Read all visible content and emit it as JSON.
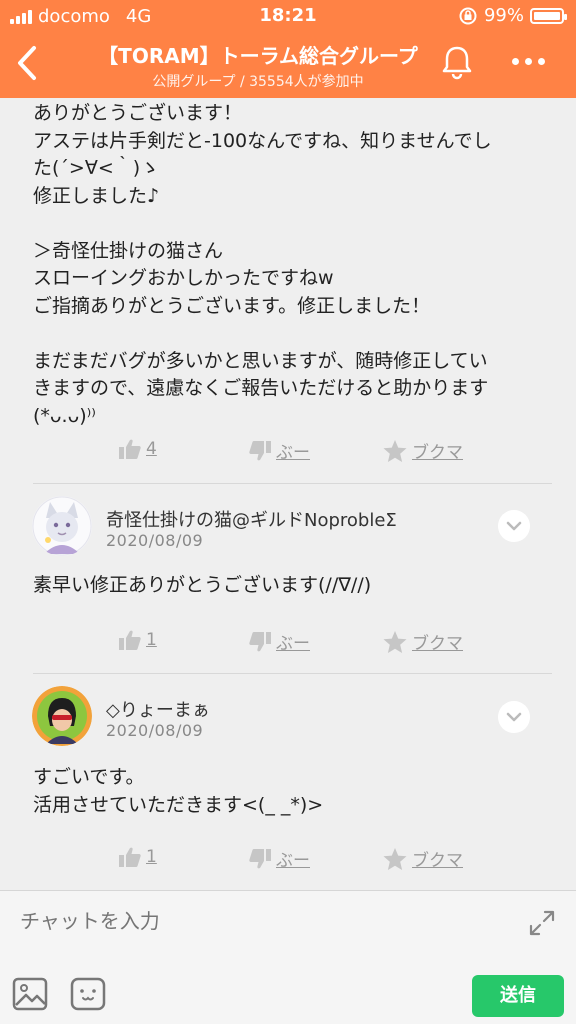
{
  "status_bar": {
    "carrier": "docomo",
    "network": "4G",
    "time": "18:21",
    "battery": "99%",
    "battery_level": 0.99
  },
  "header": {
    "title": "【TORAM】トーラム総合グループ",
    "subtitle": "公開グループ / 35554人が参加中",
    "back_icon": "chevron-left-icon",
    "bell_icon": "bell-icon",
    "more_icon": "more-icon"
  },
  "messages": [
    {
      "text": "ありがとうございます！\nアステは片手剣だと-100なんですね、知りませんでし\nた(´>∀<｀)ゝ\n修正しました♪\n\n＞奇怪仕掛けの猫さん\nスローイングおかしかったですねw\nご指摘ありがとうございます。修正しました！\n\nまだまだバグが多いかと思いますが、随時修正してい\nきますので、遠慮なくご報告いただけると助かります\n(*ᴗ.ᴗ)⁾⁾",
      "likes": "4",
      "dislike_label": "ぶー",
      "bookmark_label": "ブクマ"
    },
    {
      "author": "奇怪仕掛けの猫@ギルドNoprobleΣ",
      "date": "2020/08/09",
      "text": "素早い修正ありがとうございます(//∇//)",
      "likes": "1",
      "dislike_label": "ぶー",
      "bookmark_label": "ブクマ"
    },
    {
      "author": "◇りょーまぁ",
      "date": "2020/08/09",
      "text": "すごいです。\n活用させていただきます<(_ _*)>",
      "likes": "1",
      "dislike_label": "ぶー",
      "bookmark_label": "ブクマ"
    }
  ],
  "input": {
    "placeholder": "チャットを入力",
    "send_label": "送信"
  },
  "colors": {
    "header": "#ff8245",
    "send": "#27c86a",
    "background": "#efefef"
  }
}
